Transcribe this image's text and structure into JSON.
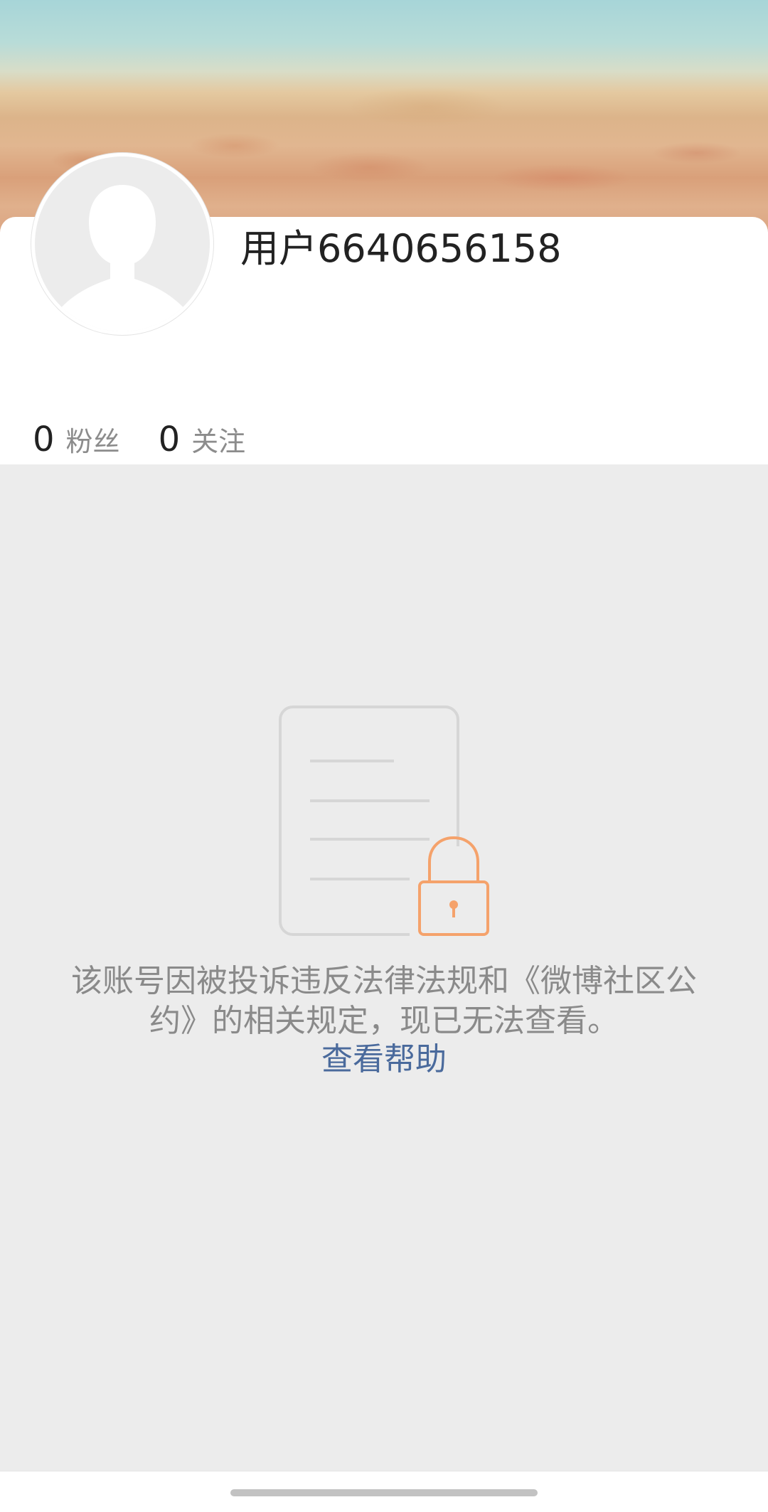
{
  "profile": {
    "username": "用户6640656158",
    "avatar_icon": "default-avatar-icon"
  },
  "stats": {
    "fans": {
      "count": "0",
      "label": "粉丝"
    },
    "following": {
      "count": "0",
      "label": "关注"
    }
  },
  "empty_state": {
    "icon": "locked-document-icon",
    "message": "该账号因被投诉违反法律法规和《微博社区公约》的相关规定，现已无法查看。",
    "help_link": "查看帮助"
  },
  "colors": {
    "page_background": "#ececec",
    "card_background": "#ffffff",
    "link": "#4a6a9c",
    "lock_accent": "#f5a26b",
    "muted_text": "#8a8a8a"
  }
}
